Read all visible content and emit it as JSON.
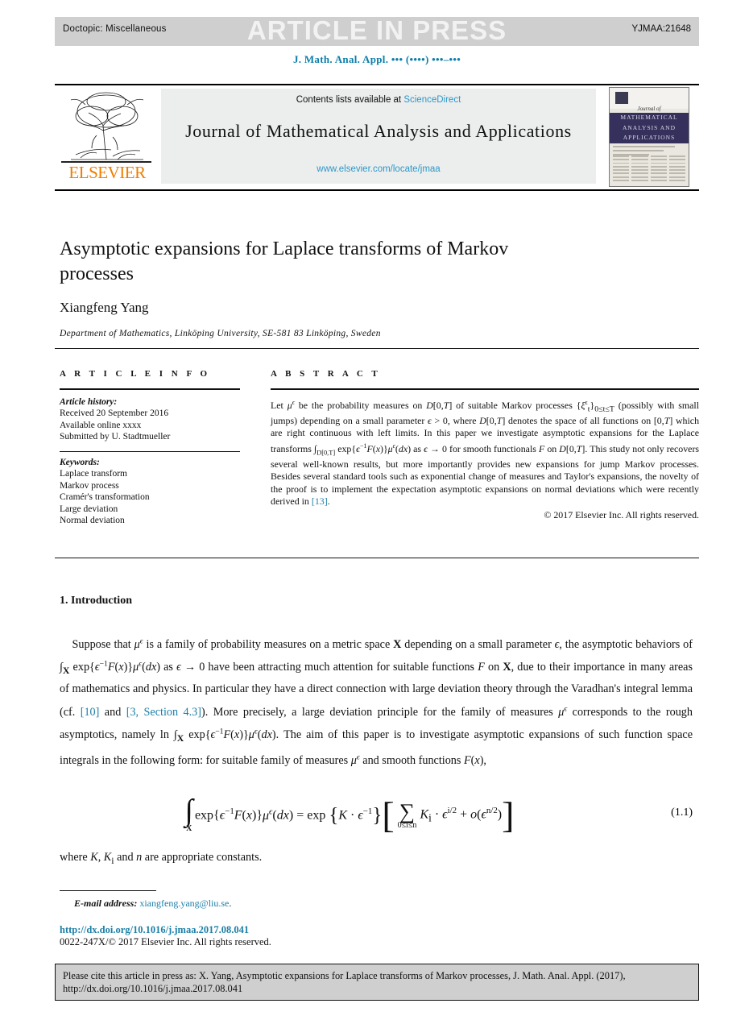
{
  "press_bar": {
    "doctopic": "Doctopic: Miscellaneous",
    "status": "ARTICLE IN PRESS",
    "article_code": "YJMAA:21648"
  },
  "running_head": "J. Math. Anal. Appl. ••• (••••) •••–•••",
  "masthead": {
    "contents_prefix": "Contents lists available at ",
    "contents_link": "ScienceDirect",
    "journal_name": "Journal of Mathematical Analysis and Applications",
    "journal_url": "www.elsevier.com/locate/jmaa",
    "publisher": "ELSEVIER",
    "cover": {
      "journal_of": "Journal of",
      "line1": "MATHEMATICAL",
      "line2": "ANALYSIS AND",
      "line3": "APPLICATIONS"
    }
  },
  "article": {
    "title": "Asymptotic expansions for Laplace transforms of Markov processes",
    "author": "Xiangfeng Yang",
    "affiliation": "Department of Mathematics, Linköping University, SE-581 83 Linköping, Sweden"
  },
  "info": {
    "heading": "A R T I C L E   I N F O",
    "history_label": "Article history:",
    "history": [
      "Received 20 September 2016",
      "Available online xxxx",
      "Submitted by U. Stadtmueller"
    ],
    "keywords_label": "Keywords:",
    "keywords": [
      "Laplace transform",
      "Markov process",
      "Cramér's transformation",
      "Large deviation",
      "Normal deviation"
    ]
  },
  "abstract": {
    "heading": "A B S T R A C T",
    "ref_label": "[13]",
    "copyright": "© 2017 Elsevier Inc. All rights reserved."
  },
  "section1": {
    "heading": "1. Introduction",
    "ref_10": "[10]",
    "ref_3": "[3, Section 4.3]",
    "equation_number": "(1.1)",
    "where_line": "where K, Kᵢ and n are appropriate constants."
  },
  "footer": {
    "email_label": "E-mail address:",
    "email": "xiangfeng.yang@liu.se",
    "email_period": ".",
    "doi": "http://dx.doi.org/10.1016/j.jmaa.2017.08.041",
    "issn": "0022-247X/© 2017 Elsevier Inc. All rights reserved."
  },
  "cite_box": {
    "text": "Please cite this article in press as: X. Yang, Asymptotic expansions for Laplace transforms of Markov processes, J. Math. Anal. Appl. (2017), http://dx.doi.org/10.1016/j.jmaa.2017.08.041"
  },
  "colors": {
    "press_bar_bg": "#cfcfcf",
    "link_blue": "#1b7fa8",
    "sciencedirect_blue": "#2b99c9",
    "elsevier_orange": "#ef7d00",
    "cover_band": "#35315c"
  }
}
